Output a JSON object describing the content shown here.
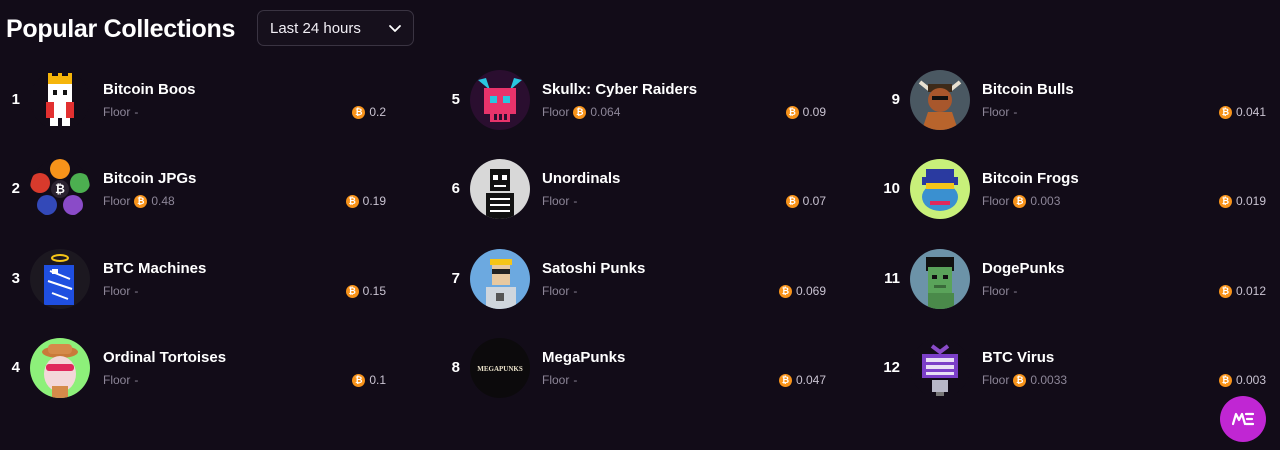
{
  "header": {
    "title": "Popular Collections",
    "period_selected": "Last 24 hours"
  },
  "floor_label": "Floor",
  "coin_symbol": "₿",
  "collections": [
    {
      "rank": "1",
      "name": "Bitcoin Boos",
      "floor": "-",
      "volume": "0.2",
      "thumb": "pixel-king-avatar"
    },
    {
      "rank": "2",
      "name": "Bitcoin JPGs",
      "floor": "0.48",
      "volume": "0.19",
      "thumb": "colored-dots-avatar"
    },
    {
      "rank": "3",
      "name": "BTC Machines",
      "floor": "-",
      "volume": "0.15",
      "thumb": "blue-robot-avatar"
    },
    {
      "rank": "4",
      "name": "Ordinal Tortoises",
      "floor": "-",
      "volume": "0.1",
      "thumb": "tortoise-avatar"
    },
    {
      "rank": "5",
      "name": "Skullx: Cyber Raiders",
      "floor": "0.064",
      "volume": "0.09",
      "thumb": "cyber-skull-avatar"
    },
    {
      "rank": "6",
      "name": "Unordinals",
      "floor": "-",
      "volume": "0.07",
      "thumb": "skeleton-avatar"
    },
    {
      "rank": "7",
      "name": "Satoshi Punks",
      "floor": "-",
      "volume": "0.069",
      "thumb": "punk-avatar"
    },
    {
      "rank": "8",
      "name": "MegaPunks",
      "floor": "-",
      "volume": "0.047",
      "thumb": "megapunks-logo",
      "logo_text": "MEGAPUNKS"
    },
    {
      "rank": "9",
      "name": "Bitcoin Bulls",
      "floor": "-",
      "volume": "0.041",
      "thumb": "bull-avatar"
    },
    {
      "rank": "10",
      "name": "Bitcoin Frogs",
      "floor": "0.003",
      "volume": "0.019",
      "thumb": "frog-avatar"
    },
    {
      "rank": "11",
      "name": "DogePunks",
      "floor": "-",
      "volume": "0.012",
      "thumb": "dogepunk-avatar"
    },
    {
      "rank": "12",
      "name": "BTC Virus",
      "floor": "0.0033",
      "volume": "0.003",
      "thumb": "virus-avatar"
    }
  ],
  "colors": {
    "background": "#120c18",
    "coin": "#f7931a",
    "muted": "#8d8698",
    "brand": "#c026d3"
  },
  "fab": {
    "label": "ME",
    "icon": "magic-eden-logo-icon"
  }
}
